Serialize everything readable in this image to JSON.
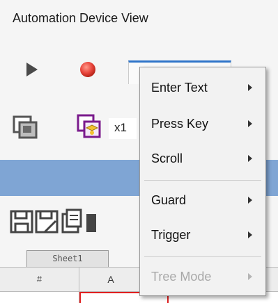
{
  "window": {
    "title": "Automation Device View"
  },
  "toolbar": {
    "play_icon": "play-icon",
    "record_icon": "record-icon",
    "zoom_value": "x1"
  },
  "sheet": {
    "tab_label": "Sheet1",
    "columns": [
      "#",
      "A"
    ]
  },
  "context_menu": {
    "items": [
      {
        "label": "Enter Text",
        "has_submenu": true,
        "enabled": true
      },
      {
        "label": "Press Key",
        "has_submenu": true,
        "enabled": true
      },
      {
        "label": "Scroll",
        "has_submenu": true,
        "enabled": true
      },
      {
        "label": "Guard",
        "has_submenu": true,
        "enabled": true
      },
      {
        "label": "Trigger",
        "has_submenu": true,
        "enabled": true
      },
      {
        "label": "Tree Mode",
        "has_submenu": true,
        "enabled": false
      }
    ]
  },
  "colors": {
    "accent_blue": "#2e74c9",
    "header_bar": "#7fa5d4",
    "record_red": "#e8453c",
    "selection_red": "#e02020"
  }
}
